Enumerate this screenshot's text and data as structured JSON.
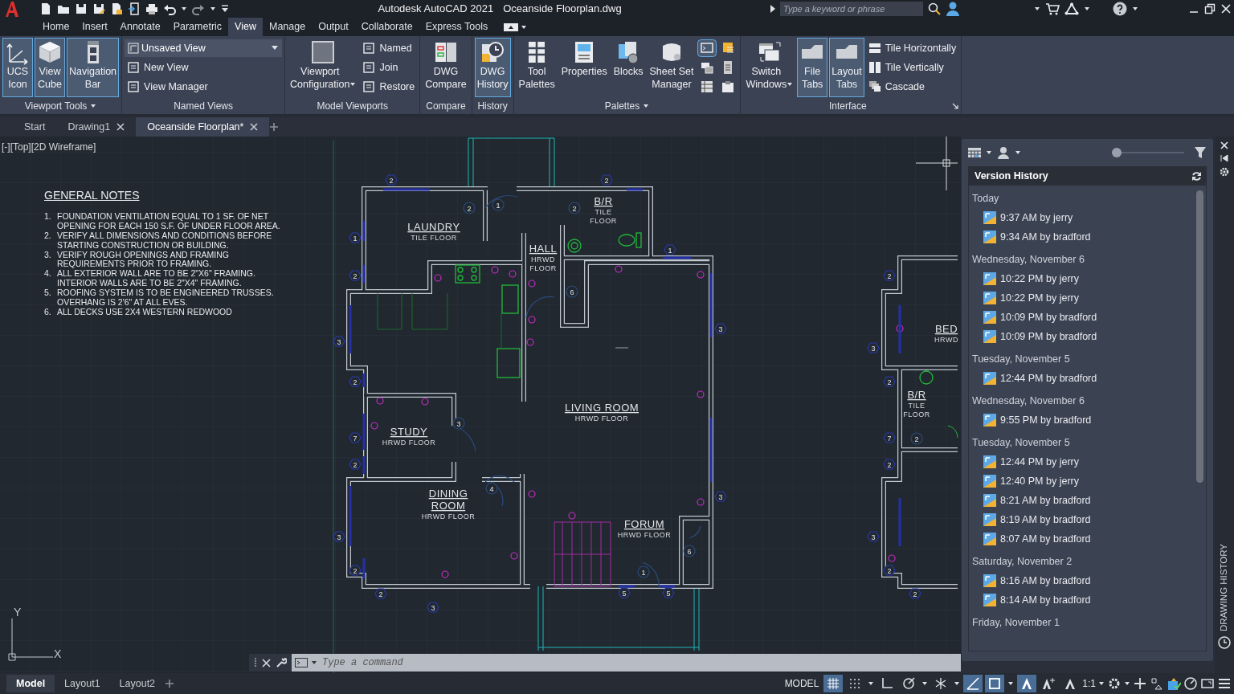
{
  "title_bar": {
    "app_title": "Autodesk AutoCAD 2021",
    "document_title": "Oceanside Floorplan.dwg",
    "search": {
      "placeholder": "Type a keyword or phrase"
    }
  },
  "ribbon_tabs": [
    {
      "label": "Home",
      "selected": false
    },
    {
      "label": "Insert",
      "selected": false
    },
    {
      "label": "Annotate",
      "selected": false
    },
    {
      "label": "Parametric",
      "selected": false
    },
    {
      "label": "View",
      "selected": true
    },
    {
      "label": "Manage",
      "selected": false
    },
    {
      "label": "Output",
      "selected": false
    },
    {
      "label": "Collaborate",
      "selected": false
    },
    {
      "label": "Express Tools",
      "selected": false
    }
  ],
  "ribbon_panels": [
    {
      "title": "Viewport Tools",
      "menu": true,
      "items": [
        {
          "kind": "large",
          "label": "UCS\nIcon",
          "on": true
        },
        {
          "kind": "large",
          "label": "View\nCube",
          "on": true
        },
        {
          "kind": "large",
          "label": "Navigation\nBar",
          "on": true
        }
      ]
    },
    {
      "title": "Named Views",
      "items": [
        {
          "kind": "dropdown",
          "label": "Unsaved View"
        },
        {
          "kind": "small",
          "label": "New View"
        },
        {
          "kind": "small",
          "label": "View Manager"
        }
      ]
    },
    {
      "title": "Model Viewports",
      "items": [
        {
          "kind": "large",
          "label": "Viewport\nConfiguration",
          "on": false,
          "caret": true
        },
        {
          "kind": "small",
          "label": "Named"
        },
        {
          "kind": "small",
          "label": "Join"
        },
        {
          "kind": "small",
          "label": "Restore"
        }
      ]
    },
    {
      "title": "Compare",
      "items": [
        {
          "kind": "large",
          "label": "DWG\nCompare",
          "on": false
        }
      ]
    },
    {
      "title": "History",
      "items": [
        {
          "kind": "large",
          "label": "DWG\nHistory",
          "on": true
        }
      ]
    },
    {
      "title": "Palettes",
      "menu": true,
      "items": [
        {
          "kind": "large",
          "label": "Tool\nPalettes",
          "on": false
        },
        {
          "kind": "large",
          "label": "Properties",
          "on": false
        },
        {
          "kind": "large",
          "label": "Blocks",
          "on": false
        },
        {
          "kind": "large",
          "label": "Sheet Set\nManager",
          "on": false
        },
        {
          "kind": "icons",
          "buttons": [
            {
              "on": true
            },
            {
              "on": false
            },
            {
              "on": false
            },
            {
              "on": false
            },
            {
              "on": false
            },
            {
              "on": false
            }
          ]
        }
      ]
    },
    {
      "title": "Interface",
      "launcher": true,
      "items": [
        {
          "kind": "large",
          "label": "Switch\nWindows",
          "on": false,
          "caret": true
        },
        {
          "kind": "large",
          "label": "File\nTabs",
          "on": true
        },
        {
          "kind": "large",
          "label": "Layout\nTabs",
          "on": true
        },
        {
          "kind": "small",
          "label": "Tile Horizontally"
        },
        {
          "kind": "small",
          "label": "Tile Vertically"
        },
        {
          "kind": "small",
          "label": "Cascade"
        }
      ]
    }
  ],
  "file_tabs": [
    {
      "label": "Start",
      "selected": false
    },
    {
      "label": "Drawing1",
      "selected": false,
      "close": true
    },
    {
      "label": "Oceanside Floorplan*",
      "selected": true,
      "close": true
    }
  ],
  "viewport_label": "[-][Top][2D Wireframe]",
  "general_notes": {
    "title": "GENERAL NOTES",
    "notes": [
      {
        "number": "1.",
        "text": "FOUNDATION VENTILATION EQUAL TO 1 SF. OF NET OPENING FOR EACH 150 S.F. OF UNDER FLOOR AREA."
      },
      {
        "number": "2.",
        "text": "VERIFY ALL DIMENSIONS AND CONDITIONS BEFORE STARTING CONSTRUCTION OR BUILDING."
      },
      {
        "number": "3.",
        "text": "VERIFY ROUGH OPENINGS AND FRAMING REQUIREMENTS PRIOR TO FRAMING."
      },
      {
        "number": "4.",
        "text": "ALL EXTERIOR WALL ARE TO BE 2\"X6\" FRAMING. INTERIOR WALLS ARE TO BE 2\"X4\" FRAMING."
      },
      {
        "number": "5.",
        "text": "ROOFING SYSTEM IS TO BE ENGINEERED TRUSSES. OVERHANG IS 2'6\" AT ALL EVES."
      },
      {
        "number": "6.",
        "text": "ALL DECKS USE 2X4 WESTERN REDWOOD"
      }
    ]
  },
  "floor_plan": {
    "rooms": [
      {
        "name": [
          "B/R"
        ],
        "floor": [
          "TILE",
          "FLOOR"
        ]
      },
      {
        "name": [
          "LAUNDRY"
        ],
        "floor": [
          "TILE FLOOR"
        ]
      },
      {
        "name": [
          "HALL"
        ],
        "floor": [
          "HRWD",
          "FLOOR"
        ]
      },
      {
        "name": [
          "BED"
        ],
        "floor": [
          "HRWD"
        ]
      },
      {
        "name": [
          "B/R"
        ],
        "floor": [
          "TILE",
          "FLOOR"
        ]
      },
      {
        "name": [
          "LIVING ROOM"
        ],
        "floor": [
          "HRWD FLOOR"
        ]
      },
      {
        "name": [
          "STUDY"
        ],
        "floor": [
          "HRWD FLOOR"
        ]
      },
      {
        "name": [
          "DINING",
          "ROOM"
        ],
        "floor": [
          "HRWD FLOOR"
        ]
      },
      {
        "name": [
          "FORUM"
        ],
        "floor": [
          "HRWD FLOOR"
        ]
      }
    ],
    "tags": [
      {
        "label": "2",
        "kind": "window"
      },
      {
        "label": "2",
        "kind": "window"
      },
      {
        "label": "2",
        "kind": "door"
      },
      {
        "label": "1",
        "kind": "door"
      },
      {
        "label": "2",
        "kind": "door"
      },
      {
        "label": "1",
        "kind": "window"
      },
      {
        "label": "1",
        "kind": "window"
      },
      {
        "label": "2",
        "kind": "window"
      },
      {
        "label": "2",
        "kind": "window"
      },
      {
        "label": "6",
        "kind": "door"
      },
      {
        "label": "3",
        "kind": "window"
      },
      {
        "label": "3",
        "kind": "window"
      },
      {
        "label": "3",
        "kind": "window"
      },
      {
        "label": "2",
        "kind": "window"
      },
      {
        "label": "2",
        "kind": "window"
      },
      {
        "label": "3",
        "kind": "door"
      },
      {
        "label": "7",
        "kind": "window"
      },
      {
        "label": "7",
        "kind": "window"
      },
      {
        "label": "2",
        "kind": "door"
      },
      {
        "label": "2",
        "kind": "window"
      },
      {
        "label": "2",
        "kind": "window"
      },
      {
        "label": "4",
        "kind": "door"
      },
      {
        "label": "3",
        "kind": "window"
      },
      {
        "label": "3",
        "kind": "window"
      },
      {
        "label": "3",
        "kind": "window"
      },
      {
        "label": "6",
        "kind": "door"
      },
      {
        "label": "2",
        "kind": "window"
      },
      {
        "label": "1",
        "kind": "door"
      },
      {
        "label": "2",
        "kind": "window"
      },
      {
        "label": "2",
        "kind": "window"
      },
      {
        "label": "5",
        "kind": "window"
      },
      {
        "label": "5",
        "kind": "window"
      },
      {
        "label": "2",
        "kind": "window"
      },
      {
        "label": "3",
        "kind": "window"
      }
    ]
  },
  "ucs": {
    "y_label": "Y",
    "x_label": "X"
  },
  "command_line": {
    "placeholder": "Type a command"
  },
  "history_palette": {
    "title": "Version History",
    "level": 0,
    "side_title": "DRAWING HISTORY",
    "groups": [
      {
        "date": "Today",
        "versions": [
          "9:37 AM by jerry",
          "9:34 AM by bradford"
        ]
      },
      {
        "date": "Wednesday, November 6",
        "versions": [
          "10:22 PM by jerry",
          "10:22 PM by jerry",
          "10:09 PM by bradford",
          "10:09 PM by bradford"
        ]
      },
      {
        "date": "Tuesday, November 5",
        "versions": [
          "12:44 PM by bradford"
        ]
      },
      {
        "date": "Wednesday, November 6",
        "versions": [
          "9:55 PM by bradford"
        ]
      },
      {
        "date": "Tuesday, November 5",
        "versions": [
          "12:44 PM by jerry",
          "12:40 PM by jerry",
          "8:21 AM by bradford",
          "8:19 AM by bradford",
          "8:07 AM by bradford"
        ]
      },
      {
        "date": "Saturday, November 2",
        "versions": [
          "8:16 AM by bradford",
          "8:14 AM by bradford"
        ]
      },
      {
        "date": "Friday, November 1"
      }
    ]
  },
  "layout_tabs": [
    {
      "label": "Model",
      "selected": true
    },
    {
      "label": "Layout1",
      "selected": false
    },
    {
      "label": "Layout2",
      "selected": false
    }
  ],
  "status_bar": {
    "space": "MODEL",
    "scale": "1:1",
    "toggles": [
      {
        "on": true
      },
      {
        "on": false
      },
      {
        "on": false
      },
      {
        "on": false
      },
      {
        "on": false
      },
      {
        "on": true
      },
      {
        "on": true
      },
      {
        "on": true
      }
    ]
  }
}
